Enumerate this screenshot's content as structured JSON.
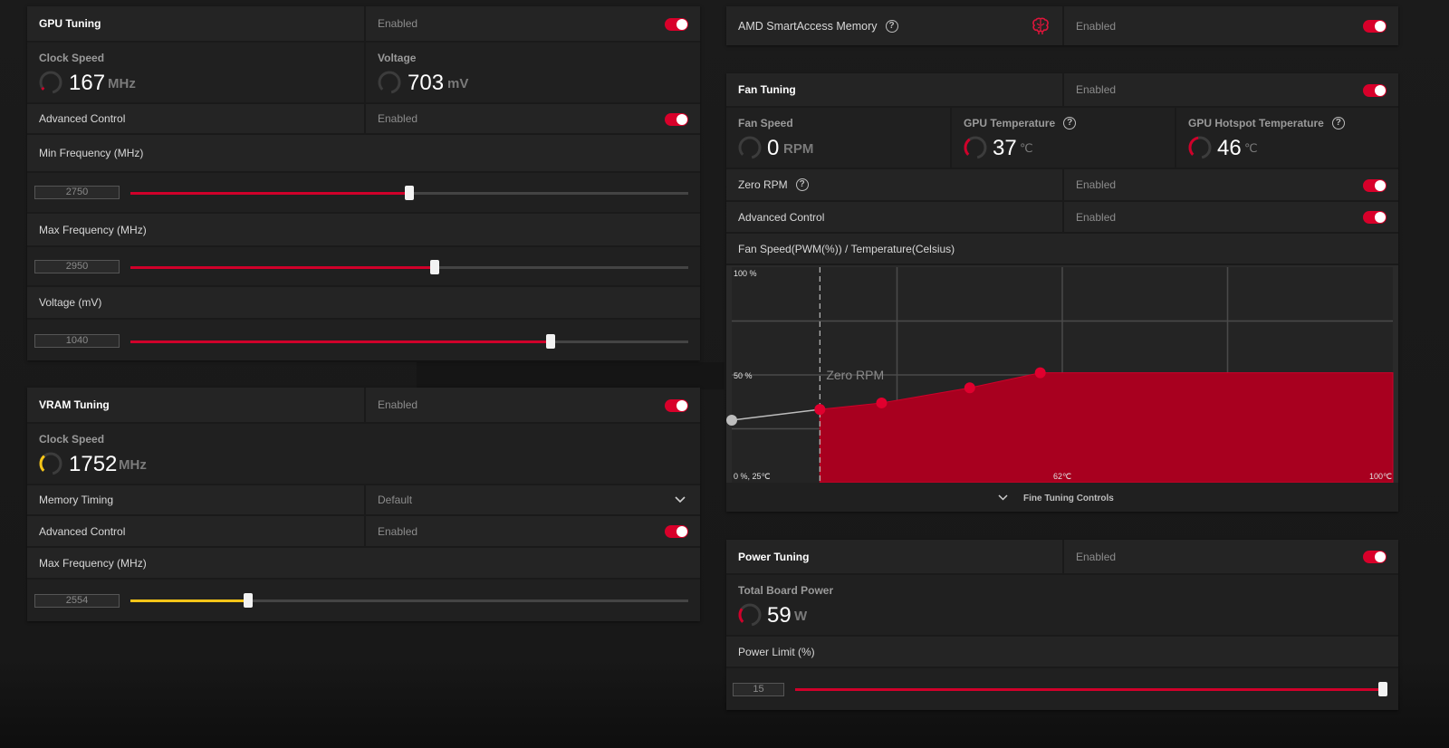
{
  "gpu_tuning": {
    "title": "GPU Tuning",
    "status": "Enabled",
    "clock_speed": {
      "label": "Clock Speed",
      "value": "167",
      "unit": "MHz",
      "level": 0.05
    },
    "voltage": {
      "label": "Voltage",
      "value": "703",
      "unit": "mV",
      "level": 0.0
    },
    "advanced_control": {
      "label": "Advanced Control",
      "status": "Enabled"
    },
    "min_frequency": {
      "label": "Min Frequency (MHz)",
      "value": "2750",
      "fraction": 0.5
    },
    "max_frequency": {
      "label": "Max Frequency (MHz)",
      "value": "2950",
      "fraction": 0.546
    },
    "voltage_slider": {
      "label": "Voltage (mV)",
      "value": "1040",
      "fraction": 0.754
    }
  },
  "vram_tuning": {
    "title": "VRAM Tuning",
    "status": "Enabled",
    "clock_speed": {
      "label": "Clock Speed",
      "value": "1752",
      "unit": "MHz",
      "level": 0.35
    },
    "memory_timing": {
      "label": "Memory Timing",
      "value": "Default"
    },
    "advanced_control": {
      "label": "Advanced Control",
      "status": "Enabled"
    },
    "max_frequency": {
      "label": "Max Frequency (MHz)",
      "value": "2554",
      "fraction": 0.211
    }
  },
  "smart_access_memory": {
    "label": "AMD SmartAccess Memory",
    "status": "Enabled"
  },
  "fan_tuning": {
    "title": "Fan Tuning",
    "status": "Enabled",
    "fan_speed": {
      "label": "Fan Speed",
      "value": "0",
      "unit": "RPM",
      "level": 0.0
    },
    "gpu_temperature": {
      "label": "GPU Temperature",
      "value": "37",
      "unit": "℃",
      "level": 0.37
    },
    "gpu_hotspot_temperature": {
      "label": "GPU Hotspot Temperature",
      "value": "46",
      "unit": "℃",
      "level": 0.46
    },
    "zero_rpm": {
      "label": "Zero RPM",
      "status": "Enabled"
    },
    "advanced_control": {
      "label": "Advanced Control",
      "status": "Enabled"
    },
    "curve_title": "Fan Speed(PWM(%)) / Temperature(Celsius)",
    "fine_tuning_label": "Fine Tuning Controls"
  },
  "power_tuning": {
    "title": "Power Tuning",
    "status": "Enabled",
    "total_board_power": {
      "label": "Total Board Power",
      "value": "59",
      "unit": "W",
      "level": 0.3
    },
    "power_limit": {
      "label": "Power Limit (%)",
      "value": "15",
      "fraction": 1.0
    }
  },
  "colors": {
    "accent_red": "#d0002a",
    "accent_yellow": "#f5c518",
    "panel": "#242424"
  },
  "chart_data": {
    "type": "area",
    "title": "Fan Speed(PWM(%)) / Temperature(Celsius)",
    "xlabel": "",
    "ylabel": "",
    "ylim": [
      0,
      100
    ],
    "xlim": [
      25,
      100
    ],
    "y_tick_labels": [
      "100 %",
      "50 %",
      "0 %, 25℃"
    ],
    "x_tick_labels": [
      "62℃",
      "100℃"
    ],
    "zero_rpm_label": "Zero RPM",
    "zero_rpm_x": 35,
    "grid": true,
    "x": [
      25,
      35,
      42,
      52,
      60
    ],
    "y": [
      29,
      34,
      37,
      44,
      51
    ],
    "active_from_index": 1,
    "fill_to_x": 100
  }
}
